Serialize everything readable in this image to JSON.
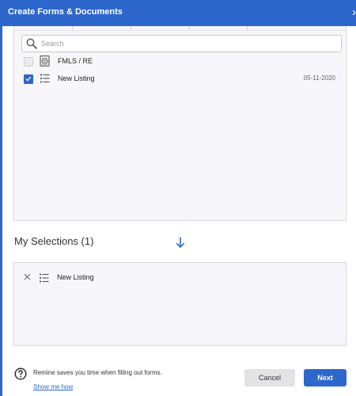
{
  "dialog": {
    "title": "Create Forms & Documents",
    "close_icon": "close-icon",
    "accent_color": "#2e67cc"
  },
  "search": {
    "placeholder": "Search",
    "value": ""
  },
  "documents": [
    {
      "label": "FMLS / RE",
      "checked": false,
      "icon": "form-document-icon",
      "date": ""
    },
    {
      "label": "New Listing",
      "checked": true,
      "icon": "checklist-icon",
      "date": "05-11-2020"
    }
  ],
  "selections": {
    "title": "My Selections (1)",
    "items": [
      {
        "label": "New Listing",
        "icon": "checklist-icon",
        "remove_icon": "remove-icon"
      }
    ]
  },
  "footer": {
    "promo_text": "Remine saves you time when filling out forms.",
    "promo_link": "Show me how",
    "cancel_label": "Cancel",
    "next_label": "Next"
  }
}
